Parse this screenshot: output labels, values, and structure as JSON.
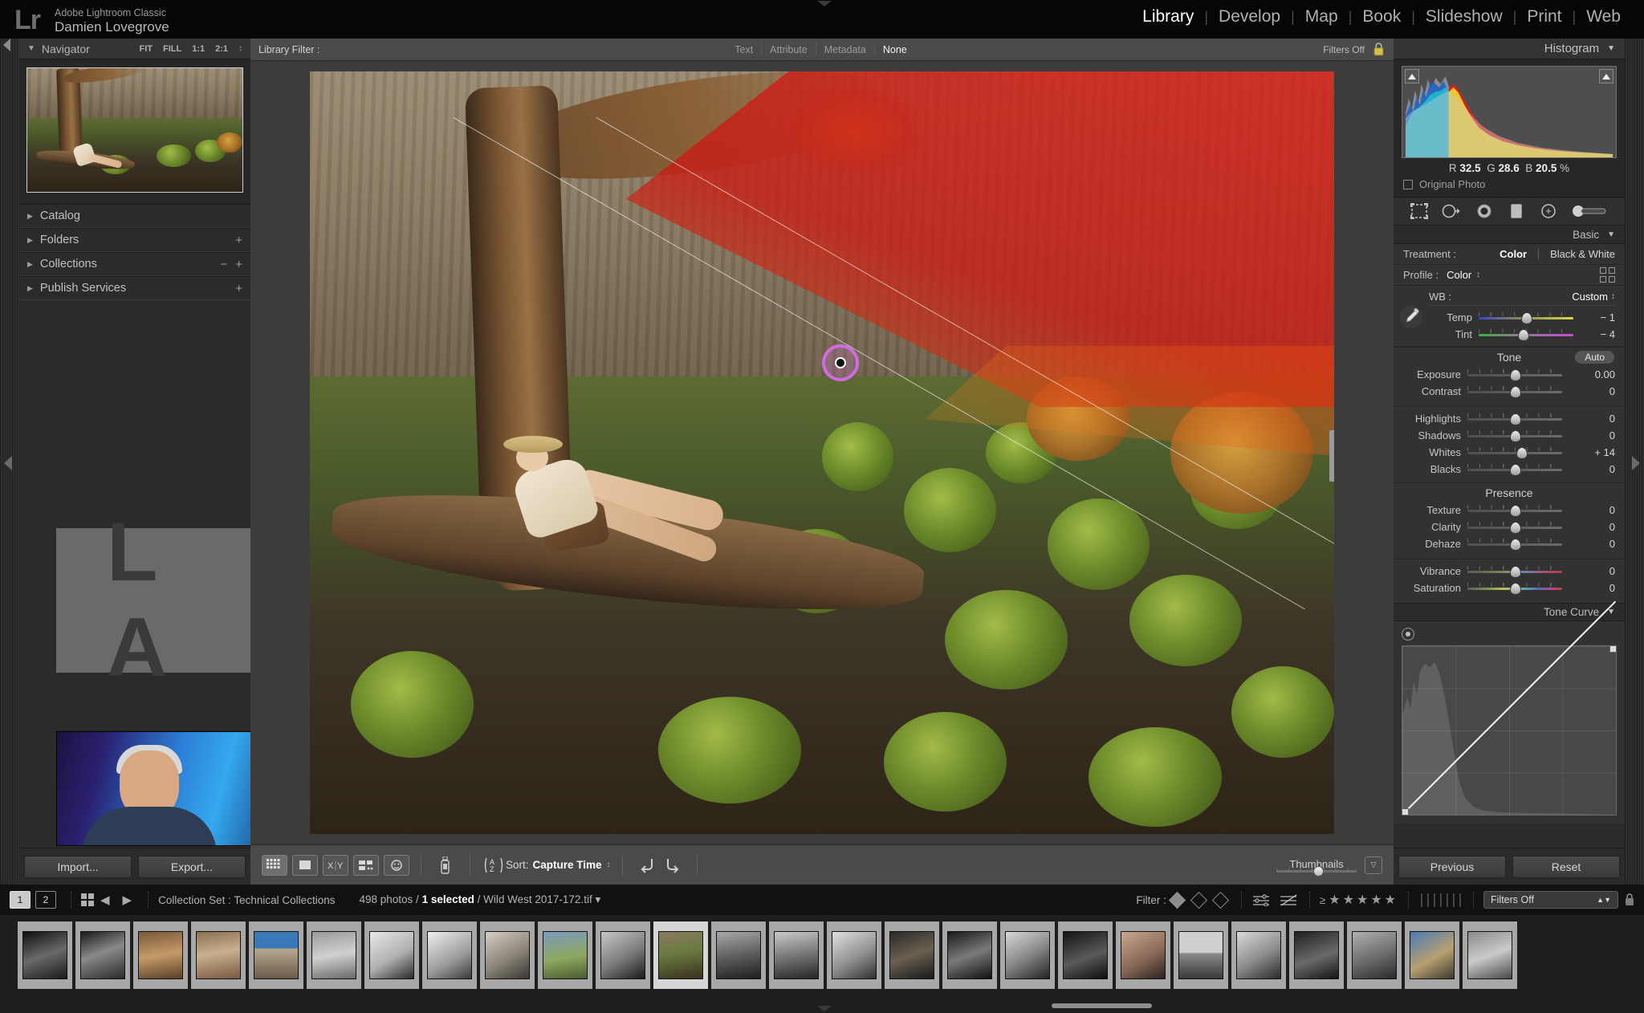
{
  "app": {
    "logo": "Lr",
    "identity_sub": "Adobe Lightroom Classic",
    "identity_name": "Damien Lovegrove"
  },
  "modules": [
    {
      "label": "Library",
      "active": true
    },
    {
      "label": "Develop",
      "active": false
    },
    {
      "label": "Map",
      "active": false
    },
    {
      "label": "Book",
      "active": false
    },
    {
      "label": "Slideshow",
      "active": false
    },
    {
      "label": "Print",
      "active": false
    },
    {
      "label": "Web",
      "active": false
    }
  ],
  "left_panel": {
    "navigator": {
      "title": "Navigator",
      "caret": "▼",
      "zoom_levels": [
        "FIT",
        "FILL",
        "1:1",
        "2:1"
      ],
      "stepper": "↕"
    },
    "sections": [
      {
        "label": "Catalog",
        "caret": "▶",
        "plus": "",
        "minus": ""
      },
      {
        "label": "Folders",
        "caret": "▶",
        "plus": "+",
        "minus": ""
      },
      {
        "label": "Collections",
        "caret": "▶",
        "plus": "+",
        "minus": "−"
      },
      {
        "label": "Publish Services",
        "caret": "▶",
        "plus": "+",
        "minus": ""
      }
    ],
    "identity_plate_mark": "L A",
    "buttons": {
      "import": "Import...",
      "export": "Export..."
    }
  },
  "library_filter": {
    "label": "Library Filter :",
    "options": [
      "Text",
      "Attribute",
      "Metadata",
      "None"
    ],
    "selected": "None",
    "filters_off": "Filters Off",
    "lock_icon": "lock-icon"
  },
  "toolbar": {
    "view_icons": [
      "grid-view-icon",
      "loupe-view-icon",
      "compare-view-icon",
      "survey-view-icon",
      "people-view-icon"
    ],
    "spray_icon": "spray-can-icon",
    "sort_icon": "sort-az-icon",
    "sort_label": "Sort:",
    "sort_value": "Capture Time",
    "sort_stepper": "↕",
    "rotate_left_icon": "rotate-left-icon",
    "rotate_right_icon": "rotate-right-icon",
    "thumbnails_label": "Thumbnails",
    "thumbnails_value": 48,
    "toolbar_caret": "▽"
  },
  "right_panel": {
    "histogram": {
      "title": "Histogram",
      "caret": "▼",
      "r_label": "R",
      "r_value": "32.5",
      "g_label": "G",
      "g_value": "28.6",
      "b_label": "B",
      "b_value": "20.5",
      "percent": "%",
      "original_photo": "Original Photo",
      "shadow_clip_icon": "shadow-clipping-icon",
      "highlight_clip_icon": "highlight-clipping-icon"
    },
    "tools": [
      "crop-overlay-icon",
      "spot-removal-icon",
      "red-eye-icon",
      "graduated-filter-icon",
      "radial-filter-icon",
      "adjustment-brush-icon"
    ],
    "basic": {
      "title": "Basic",
      "caret": "▼",
      "treatment_label": "Treatment :",
      "treatment_color": "Color",
      "treatment_bw": "Black & White",
      "profile_label": "Profile :",
      "profile_value": "Color",
      "profile_stepper": "↕",
      "profile_browser_icon": "profile-browser-icon",
      "eyedropper_icon": "white-balance-eyedropper-icon",
      "wb_label": "WB :",
      "wb_value": "Custom",
      "wb_stepper": "↕",
      "tone_label": "Tone",
      "auto_label": "Auto",
      "presence_label": "Presence",
      "sliders": [
        {
          "name": "Temp",
          "value": "− 1",
          "pos": 0.5,
          "track": "temp"
        },
        {
          "name": "Tint",
          "value": "− 4",
          "pos": 0.47,
          "track": "tint"
        },
        {
          "name": "Exposure",
          "value": "0.00",
          "pos": 0.5,
          "track": "plain"
        },
        {
          "name": "Contrast",
          "value": "0",
          "pos": 0.5,
          "track": "plain"
        },
        {
          "name": "Highlights",
          "value": "0",
          "pos": 0.5,
          "track": "plain"
        },
        {
          "name": "Shadows",
          "value": "0",
          "pos": 0.5,
          "track": "plain"
        },
        {
          "name": "Whites",
          "value": "+ 14",
          "pos": 0.57,
          "track": "plain"
        },
        {
          "name": "Blacks",
          "value": "0",
          "pos": 0.5,
          "track": "plain"
        },
        {
          "name": "Texture",
          "value": "0",
          "pos": 0.5,
          "track": "plain"
        },
        {
          "name": "Clarity",
          "value": "0",
          "pos": 0.5,
          "track": "plain"
        },
        {
          "name": "Dehaze",
          "value": "0",
          "pos": 0.5,
          "track": "plain"
        },
        {
          "name": "Vibrance",
          "value": "0",
          "pos": 0.5,
          "track": "vib"
        },
        {
          "name": "Saturation",
          "value": "0",
          "pos": 0.5,
          "track": "sat"
        }
      ]
    },
    "tone_curve": {
      "title": "Tone Curve",
      "caret": "▼",
      "target_adjust_icon": "targeted-adjustment-tool-icon"
    },
    "buttons": {
      "previous": "Previous",
      "reset": "Reset"
    }
  },
  "filmstrip": {
    "screen1": "1",
    "screen2": "2",
    "grid_icon": "filmstrip-grid-icon",
    "back_icon": "◀",
    "forward_icon": "▶",
    "source": "Collection Set : Technical Collections",
    "photo_count": "498 photos",
    "selected_count": "1 selected",
    "filename": "Wild West 2017-172.tif",
    "filename_caret": "▾",
    "filter_label": "Filter :",
    "rating_op": "≥",
    "stars": "★★★★★",
    "color_labels": [
      "#b24a4a",
      "#c6b33c",
      "#4e9e4e",
      "#4a64b8",
      "#8a4ab2",
      "#9a9a9a",
      "#6e6e6e"
    ],
    "filters_off": "Filters Off",
    "thumbs": [
      {
        "tone": "bw-portrait"
      },
      {
        "tone": "bw-doorway"
      },
      {
        "tone": "desert-color"
      },
      {
        "tone": "flag-color"
      },
      {
        "tone": "truck-color"
      },
      {
        "tone": "bw-wall"
      },
      {
        "tone": "bw-portrait2"
      },
      {
        "tone": "bw-window"
      },
      {
        "tone": "color-window"
      },
      {
        "tone": "field-color"
      },
      {
        "tone": "bw-hat"
      },
      {
        "tone": "wild-west-selected"
      },
      {
        "tone": "bw-car"
      },
      {
        "tone": "bw-scene"
      },
      {
        "tone": "bw-dress"
      },
      {
        "tone": "dark-room"
      },
      {
        "tone": "bw-interior"
      },
      {
        "tone": "bw-figure"
      },
      {
        "tone": "bw-dark"
      },
      {
        "tone": "color-portrait"
      },
      {
        "tone": "bw-landscape"
      },
      {
        "tone": "bw-standing"
      },
      {
        "tone": "bw-dim"
      },
      {
        "tone": "bw-wall2"
      },
      {
        "tone": "color-blue"
      },
      {
        "tone": "bw-arch"
      }
    ]
  },
  "canvas": {
    "mask_color": "#d01e16",
    "brush_cursor_color": "#cf6ce0",
    "image_name": "Wild West 2017-172.tif"
  }
}
